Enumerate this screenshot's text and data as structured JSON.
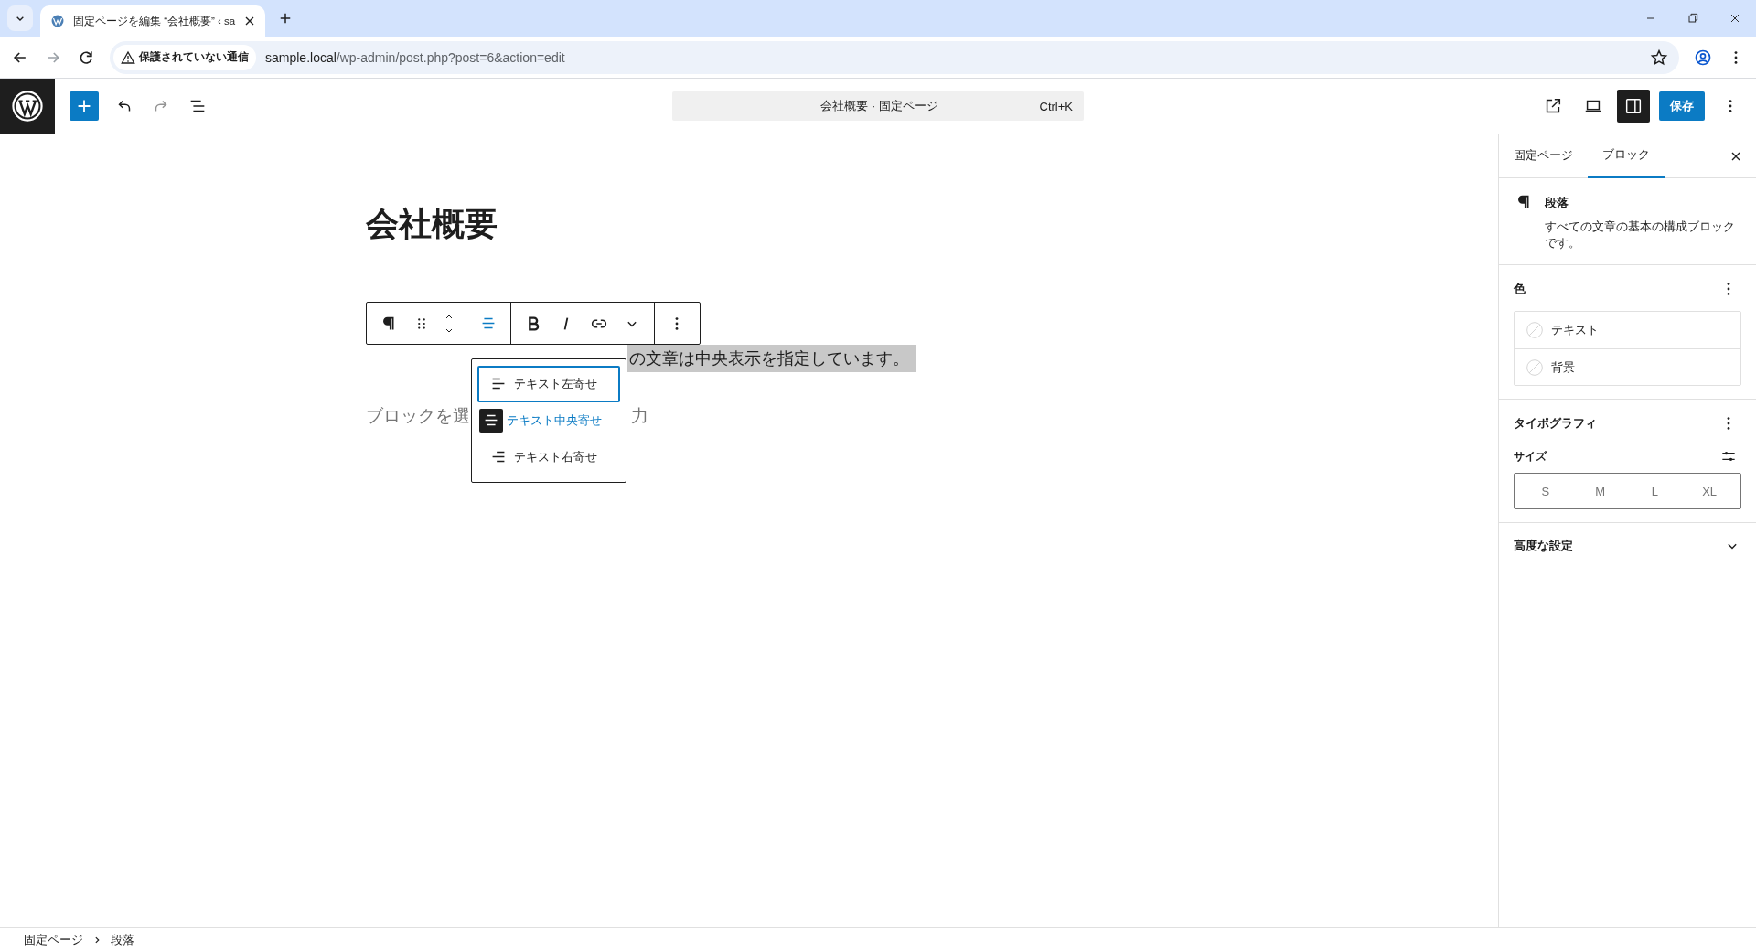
{
  "browser": {
    "tab_title": "固定ページを編集 “会社概要” ‹ sa",
    "security_label": "保護されていない通信",
    "url_host": "sample.local",
    "url_path": "/wp-admin/post.php?post=6&action=edit"
  },
  "toolbar": {
    "command_title": "会社概要 · 固定ページ",
    "shortcut": "Ctrl+K",
    "settings_selected": true,
    "save_label": "保存"
  },
  "editor": {
    "title": "会社概要",
    "paragraph": "の文章は中央表示を指定しています。",
    "placeholder_start": "ブロックを選",
    "placeholder_end": "力"
  },
  "align_menu": {
    "expanded": true,
    "items": [
      {
        "kind": "left",
        "label": "テキスト左寄せ",
        "selected": false,
        "focused": true
      },
      {
        "kind": "center",
        "label": "テキスト中央寄せ",
        "selected": true,
        "focused": false
      },
      {
        "kind": "right",
        "label": "テキスト右寄せ",
        "selected": false,
        "focused": false
      }
    ]
  },
  "sidebar": {
    "tabs": [
      {
        "label": "固定ページ",
        "selected": false
      },
      {
        "label": "ブロック",
        "selected": true
      }
    ],
    "block": {
      "name": "段落",
      "description": "すべての文章の基本の構成ブロックです。"
    },
    "color": {
      "title": "色",
      "items": [
        "テキスト",
        "背景"
      ]
    },
    "typography": {
      "title": "タイポグラフィ",
      "size_label": "サイズ",
      "sizes": [
        {
          "label": "S",
          "selected": false
        },
        {
          "label": "M",
          "selected": false
        },
        {
          "label": "L",
          "selected": false
        },
        {
          "label": "XL",
          "selected": false
        }
      ]
    },
    "advanced": {
      "title": "高度な設定",
      "expanded": false
    }
  },
  "breadcrumb": [
    "固定ページ",
    "段落"
  ]
}
